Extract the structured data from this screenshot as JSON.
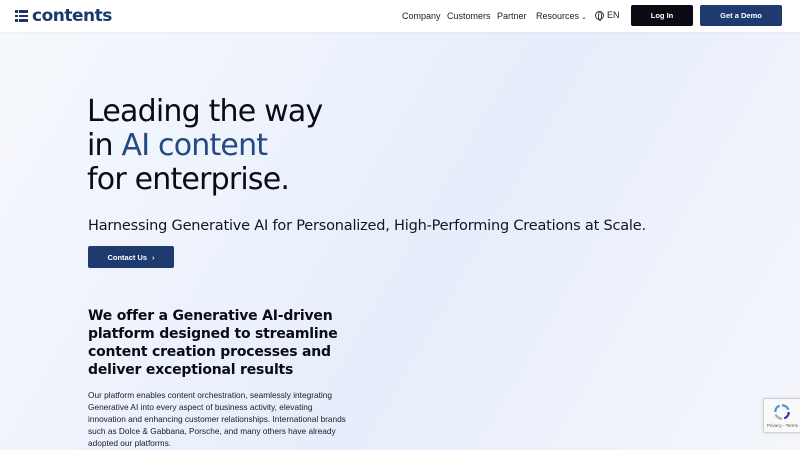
{
  "header": {
    "logo_text": "contents",
    "nav": [
      {
        "label": "Company"
      },
      {
        "label": "Customers"
      },
      {
        "label": "Partner"
      },
      {
        "label": "Resources"
      }
    ],
    "language": "EN",
    "login_label": "Log In",
    "demo_label": "Get a Demo"
  },
  "hero": {
    "title_line1": "Leading the way",
    "title_line2_prefix": "in ",
    "title_line2_accent": "AI content",
    "title_line3": "for enterprise.",
    "subtitle": "Harnessing Generative AI for Personalized, High-Performing Creations at Scale.",
    "cta_label": "Contact Us",
    "cta_arrow": "›"
  },
  "section": {
    "title": "We offer a Generative AI-driven platform designed to streamline content creation processes and deliver exceptional results",
    "body": "Our platform enables content orchestration, seamlessly integrating Generative AI into every aspect of business activity, elevating innovation and enhancing customer relationships. International brands such as Dolce & Gabbana, Porsche, and many others have already adopted our platforms."
  },
  "recaptcha": {
    "links": "Privacy - Terms"
  },
  "colors": {
    "brand": "#1e3a6e",
    "accent_text": "#234a82",
    "login_bg": "#0a0a12"
  }
}
